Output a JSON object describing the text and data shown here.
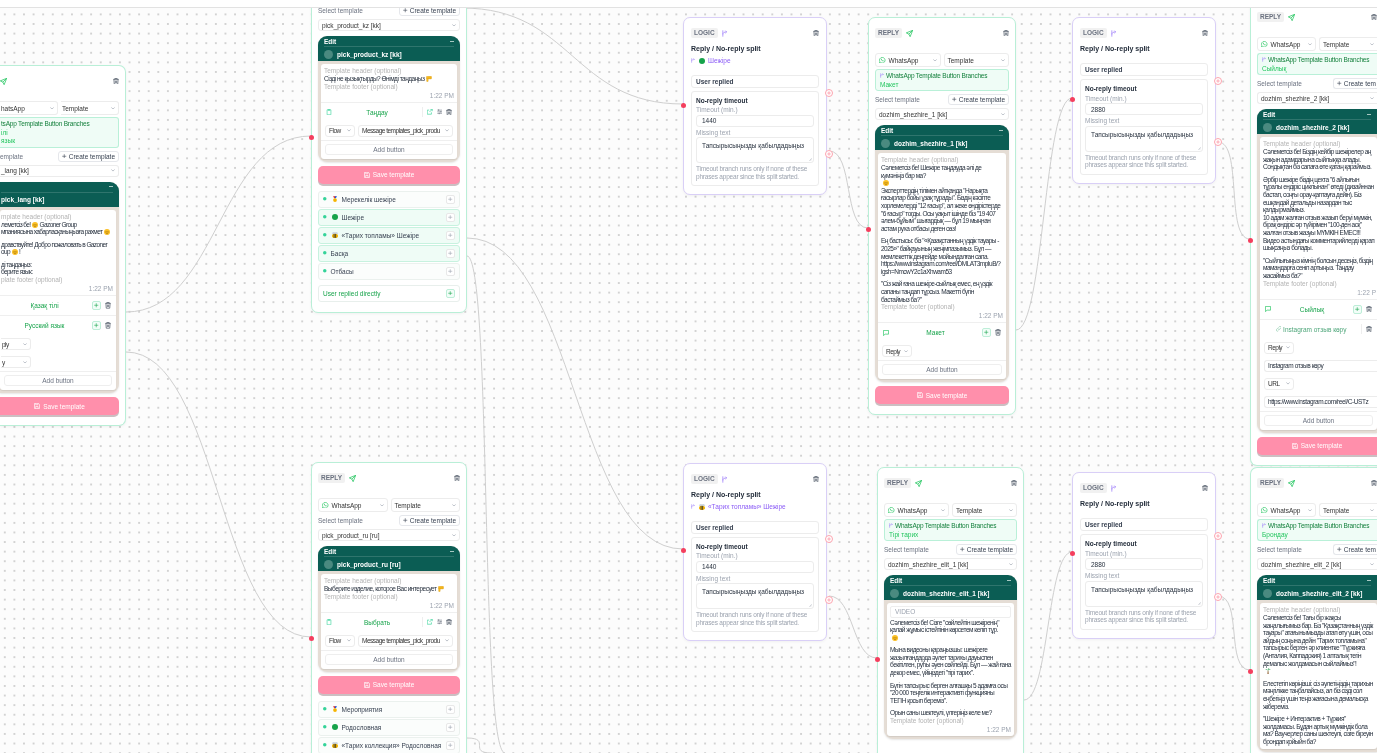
{
  "nodes": [
    {
      "kind": "reply",
      "channel": "hatsApp",
      "mode": "Template",
      "branches": {
        "title": "tsApp Template Button Branches",
        "values": [
          "ілі",
          "язык"
        ]
      },
      "select_label": "emplate",
      "create": "Create template",
      "template": "_lang [kk]",
      "preview": {
        "name": "pick_lang [kk]",
        "header": {
          "placeholder": "mplate header (optional)"
        },
        "message": [
          [
            [
              "леметсіз бе!",
              {
                "kind": "emoji"
              },
              "Gazoner Group"
            ],
            [
              "мпаниясына хабарласқаныңызға рахмет",
              {
                "kind": "emoji"
              }
            ]
          ],
          [
            [
              "дравствуйте! Добро пожаловать в Gazoner"
            ],
            [
              "oup",
              {
                "kind": "emoji"
              },
              "!"
            ]
          ],
          [
            [
              "ді таңдаңыз:"
            ],
            [
              "берите язык:"
            ]
          ]
        ],
        "footer": {
          "placeholder": "plate footer (optional)"
        },
        "time": "1:22 PM"
      },
      "buttons": [
        {
          "kind": "plain",
          "label": "Қазақ тілі"
        },
        {
          "kind": "plain",
          "label": "Русский язык"
        }
      ],
      "settings": [
        [
          {
            "kind": "select",
            "value": "ply"
          }
        ],
        [
          {
            "kind": "select",
            "value": "y"
          }
        ]
      ],
      "add": "Add button",
      "save": "Save template"
    },
    {
      "kind": "reply",
      "select_label": "Select template",
      "create": "Create template",
      "template": "pick_product_kz [kk]",
      "preview": {
        "edit": "Edit",
        "name": "pick_product_kz [kk]",
        "header": {
          "placeholder": "Template header (optional)"
        },
        "message": [
          [
            [
              "Сізді не қызықтырды? Өнімді таңдаңыз",
              {
                "kind": "emoji"
              }
            ]
          ]
        ],
        "footer": {
          "placeholder": "Template footer (optional)"
        },
        "time": "1:22 PM"
      },
      "buttons": [
        {
          "kind": "flow",
          "label": "Таңдау"
        }
      ],
      "settings": [
        [
          {
            "kind": "select",
            "value": "Flow"
          },
          {
            "kind": "select",
            "value": "Message templates_pick_produ"
          }
        ]
      ],
      "add": "Add button",
      "save": "Save template",
      "outputs": [
        {
          "label": "Мерекелік шежіре",
          "icon": true,
          "connected": false
        },
        {
          "label": "Шежіре",
          "icon": true,
          "connected": true
        },
        {
          "label": "«Тарих топламы» Шежіре",
          "icon": true,
          "connected": true
        },
        {
          "label": "Басқа",
          "icon": false,
          "connected": true
        },
        {
          "label": "Отбасы",
          "icon": false,
          "connected": false
        }
      ],
      "direct": "User replied directly"
    },
    {
      "kind": "reply",
      "tag": "REPLY",
      "channel": "WhatsApp",
      "mode": "Template",
      "select_label": "Select template",
      "create": "Create template",
      "template": "pick_product_ru [ru]",
      "preview": {
        "edit": "Edit",
        "name": "pick_product_ru [ru]",
        "header": {
          "placeholder": "Template header (optional)"
        },
        "message": [
          [
            [
              "Выберите изделие, которое Вас интересует",
              {
                "kind": "emoji"
              }
            ]
          ]
        ],
        "footer": {
          "placeholder": "Template footer (optional)"
        },
        "time": "1:22 PM"
      },
      "buttons": [
        {
          "kind": "flow",
          "label": "Выбрать"
        }
      ],
      "settings": [
        [
          {
            "kind": "select",
            "value": "Flow"
          },
          {
            "kind": "select",
            "value": "Message templates_pick_produ"
          }
        ]
      ],
      "add": "Add button",
      "save": "Save template",
      "outputs": [
        {
          "label": "Мероприятия",
          "icon": true,
          "connected": false
        },
        {
          "label": "Родословная",
          "icon": true,
          "connected": false
        },
        {
          "label": "«Тарих коллекция» Родословная",
          "icon": true,
          "connected": false
        }
      ]
    },
    {
      "kind": "logic",
      "tag": "LOGIC",
      "title": "Reply / No-reply split",
      "source": {
        "label": "Шежіре",
        "emoji": true
      },
      "replied": "User replied",
      "timeout": {
        "title": "No-reply timeout",
        "minutes_label": "Timeout (min.)",
        "minutes": "1440",
        "text_label": "Missing text",
        "text": "Тапсырысыңызды қабылдадыңыз",
        "hint": "Timeout branch runs only if none of these phrases appear since this split started."
      }
    },
    {
      "kind": "logic",
      "tag": "LOGIC",
      "title": "Reply / No-reply split",
      "source": {
        "label": "«Тарих топламы» Шежіре",
        "emoji": true
      },
      "replied": "User replied",
      "timeout": {
        "title": "No-reply timeout",
        "minutes_label": "Timeout (min.)",
        "minutes": "1440",
        "text_label": "Missing text",
        "text": "Тапсырысыңызды қабылдадыңыз",
        "hint": "Timeout branch runs only if none of these phrases appear since this split started."
      }
    },
    {
      "kind": "reply",
      "tag": "REPLY",
      "channel": "WhatsApp",
      "mode": "Template",
      "branches": {
        "title": "WhatsApp Template Button Branches",
        "values": [
          "Макет"
        ]
      },
      "select_label": "Select template",
      "create": "Create template",
      "template": "dozhim_shezhire_1 [kk]",
      "preview": {
        "edit": "Edit",
        "name": "dozhim_shezhire_1 [kk]",
        "header": {
          "placeholder": "Template header (optional)"
        },
        "message": [
          [
            [
              "Сәлеметсіз бе! Шежіре таңдауда әлі де күмәніңіз бар ма?"
            ],
            [
              {
                "kind": "emoji"
              }
            ],
            [
              "Эксперттердің тілімен айтқанда \"Нарықта ғасырлар бойы ұзақ тұрады\". Біздің кәсіпте хорлемелерді \"12 ғасыр\", ал жеке өндірістерде \"6 ғасыр\" тогды. Осы уақыт ішінде біз \"19 407 әлем-бұйым\" шығардық — бұл 19 мыңнан астам руха отбасы деген сөз!"
            ]
          ],
          [
            [
              "Ең бастысы: біз \"«Қазақстанның үздік тауары - 2025»\" байқауының жеңімпазымыз. Бұл — мемлекеттік деңгейде мойындалған сапа."
            ],
            [
              "https://www.instagram.com/reel/DMLAT3mpIuB/?igsh=NmcwY2c1aXhwam53"
            ]
          ],
          [
            [
              "\"Сіз жай ғана шежіре-сыйлық емес, ең үздік сапаны таңдап тұрсыз. Макетті бүгін бастаймыз ба?\""
            ]
          ]
        ],
        "footer": {
          "placeholder": "Template footer (optional)"
        },
        "time": "1:22 PM"
      },
      "buttons": [
        {
          "kind": "reply",
          "label": "Макет"
        }
      ],
      "settings": [
        [
          {
            "kind": "select",
            "value": "Reply"
          }
        ]
      ],
      "add": "Add button",
      "save": "Save template"
    },
    {
      "kind": "reply",
      "tag": "REPLY",
      "channel": "WhatsApp",
      "mode": "Template",
      "branches": {
        "title": "WhatsApp Template Button Branches",
        "values": [
          "Тірі тарих"
        ]
      },
      "select_label": "Select template",
      "create": "Create template",
      "template": "dozhim_shezhire_elit_1 [kk]",
      "preview": {
        "edit": "Edit",
        "name": "dozhim_shezhire_elit_1 [kk]",
        "media": "VIDEO",
        "message": [
          [
            [
              "Сәлеметсіз бе! Сізге \"сөйлейтін шежіренің\" қалай жұмыс істейтінін көрсетем келіп тұр."
            ],
            [
              {
                "kind": "emoji"
              }
            ]
          ],
          [
            [
              "Мына видеоны қараңызшы: шежіреге жазылғандарда әулет тарихы дауыспен бекітілген, руһы әуен сөйлейді. Бұл — жай ғана декор емес, үйіңіздегі \"тірі тарих\"."
            ]
          ],
          [
            [
              "Бүгін тапсырыс берген алғашқы 5 адамға осы \"20 000 теңгелік интерактивті функцияны ТЕГІН қосып береміз\"."
            ]
          ],
          [
            [
              "Орын саны шектеулі, үлгеріңіз келе ме?"
            ]
          ]
        ],
        "footer": {
          "placeholder": "Template footer (optional)"
        },
        "time": "1:22 PM"
      }
    },
    {
      "kind": "logic",
      "tag": "LOGIC",
      "title": "Reply / No-reply split",
      "replied": "User replied",
      "timeout": {
        "title": "No-reply timeout",
        "minutes_label": "Timeout (min.)",
        "minutes": "2880",
        "text_label": "Missing text",
        "text": "Тапсырысыңызды қабылдадыңыз",
        "hint": "Timeout branch runs only if none of these phrases appear since this split started."
      }
    },
    {
      "kind": "logic",
      "tag": "LOGIC",
      "title": "Reply / No-reply split",
      "replied": "User replied",
      "timeout": {
        "title": "No-reply timeout",
        "minutes_label": "Timeout (min.)",
        "minutes": "2880",
        "text_label": "Missing text",
        "text": "Тапсырысыңызды қабылдадыңыз",
        "hint": "Timeout branch runs only if none of these phrases appear since this split started."
      }
    },
    {
      "kind": "reply",
      "tag": "REPLY",
      "channel": "WhatsApp",
      "mode": "Template",
      "branches": {
        "title": "WhatsApp Template Button Branches",
        "values": [
          "Сыйлық"
        ]
      },
      "select_label": "Select template",
      "create": "Create tem",
      "template": "dozhim_shezhire_2 [kk]",
      "preview": {
        "edit": "Edit",
        "name": "dozhim_shezhire_2 [kk]",
        "header": {
          "placeholder": "Template header (optional)"
        },
        "message": [
          [
            [
              "Сәлеметсіз бе! Біздің кейбір шежірелер аң жақын адамдарына сыйлыққа алады. Сондықтан біз сапаға өте қатаң қараймыз."
            ]
          ],
          [
            [
              "Әрбір шежіре біздің цехта \"6 айлығын тұралы ендіріс циклынан\" өтеді (дизайннан бастап, соңғы орау-қаптауға дейін). Біз ешқандай детальды назардан тыс қалдырмаймыз."
            ],
            [
              "10 адам жалған отзыв жазып беруі мүмкін, бірақ өндіріс әр түйірімен \"100-ден асқ\" жалған отзыв жазуы МҮМКІН ЕМЕС!!! Видео астындағы комментарийлерді қарап шықсаңыз болады."
            ]
          ],
          [
            [
              "\"Сыйлығыңыз кімнің болсын десеңіз, біздің мамандарға сеніп артыңыз. Таңдау жасаймыз ба?\""
            ]
          ]
        ],
        "footer": {
          "placeholder": "Template footer (optional)"
        },
        "time": "1:22 P"
      },
      "buttons": [
        {
          "kind": "reply",
          "label": "Сыйлық"
        },
        {
          "kind": "url",
          "label": "Instagram отзыв көру"
        }
      ],
      "settings": [
        [
          {
            "kind": "select",
            "value": "Reply"
          }
        ],
        [
          {
            "kind": "input",
            "value": "Instagram отзыв көру"
          }
        ],
        [
          {
            "kind": "select",
            "value": "URL"
          }
        ],
        [
          {
            "kind": "input",
            "value": "https://www.instagram.com/reel/C-USTz"
          }
        ]
      ],
      "add": "Add button",
      "save": "Save template"
    },
    {
      "kind": "reply",
      "tag": "REPLY",
      "channel": "WhatsApp",
      "mode": "Template",
      "branches": {
        "title": "WhatsApp Template Button Branches",
        "values": [
          "Брондау"
        ]
      },
      "select_label": "Select template",
      "create": "Create tem",
      "template": "dozhim_shezhire_elit_2 [kk]",
      "preview": {
        "edit": "Edit",
        "name": "dozhim_shezhire_elit_2 [kk]",
        "header": {
          "placeholder": "Template header (optional)"
        },
        "message": [
          [
            [
              "Сәлеметсіз бе! Тағы бір жақсы жаңалығымыз бар. Біз \"Қазақстанның үздік тауары\" атағынымызды атап өту үшін, осы айдың соңына дейін \"Тарих топламына\" тапсырыс берген әр клиентке \"Түркияға (Анталия, Каппадокия) 1 апталық тегін демалыс жолдамасын сыйлаймыз\"!"
            ],
            [
              {
                "kind": "emoji"
              }
            ]
          ],
          [
            [
              "Елестетіп көріңізші: сіз әулетіңіздің тарихын мәңгілікке таңбалайсыз, ал біз сізді сол еңбегіңіз үшін теңіз жағасына демалысқа жібереміз."
            ]
          ],
          [
            [
              "\"Шежіре + Интерактив + Түркия\" жолдамасы. Бұдан артық мүмкіндік бола ма? Ваучерлер саны шектеулі, сізге біреуін брондап қойыйн ба?"
            ]
          ]
        ]
      }
    }
  ]
}
